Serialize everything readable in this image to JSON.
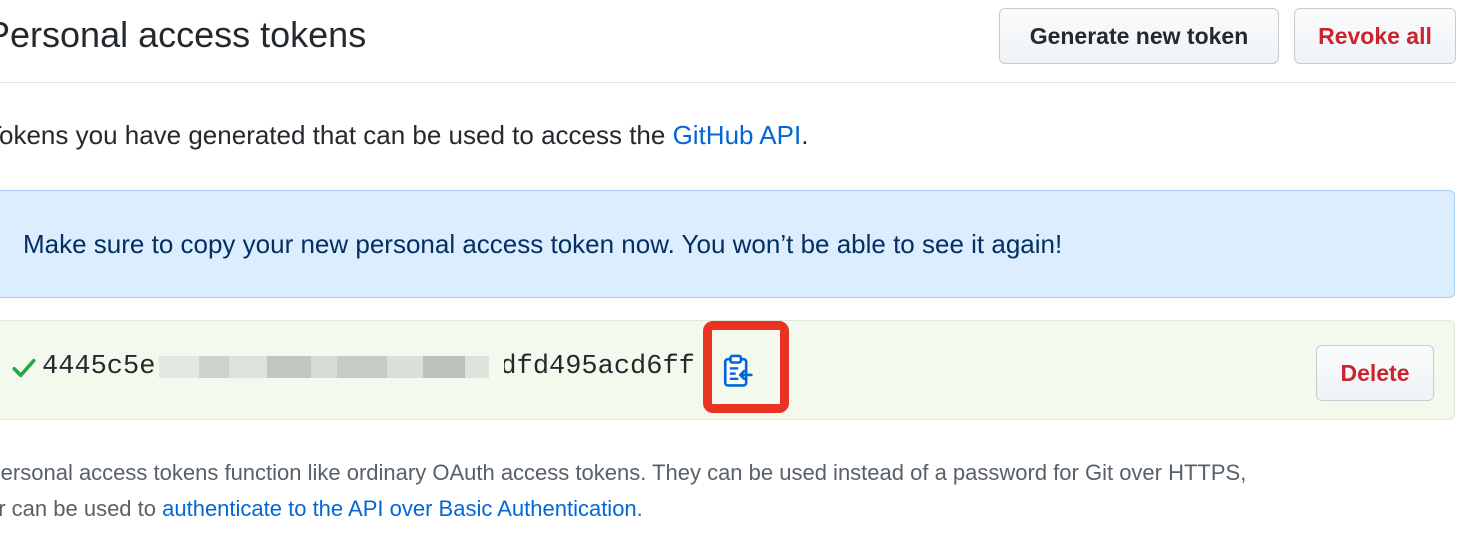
{
  "header": {
    "title": "Personal access tokens",
    "generate_button_label": "Generate new token",
    "revoke_button_label": "Revoke all"
  },
  "subhead": {
    "text_before": "Tokens you have generated that can be used to access the ",
    "link_text": "GitHub API",
    "text_after": "."
  },
  "flash": {
    "message": "Make sure to copy your new personal access token now. You won’t be able to see it again!"
  },
  "token": {
    "prefix": "4445c5e",
    "suffix": "dfd495acd6ff",
    "delete_button_label": "Delete",
    "check_icon": "check-icon",
    "copy_icon": "clipboard-icon",
    "highlight_color": "#ea3323"
  },
  "footer": {
    "line1": "Personal access tokens function like ordinary OAuth access tokens. They can be used instead of a password for Git over HTTPS,",
    "line2_before": "or can be used to ",
    "line2_link": "authenticate to the API over Basic Authentication",
    "line2_after": "."
  },
  "colors": {
    "link": "#0366d6",
    "danger": "#cb2431",
    "flash_background": "#dbedff",
    "token_background": "#f4f9ed",
    "success": "#28a745"
  }
}
